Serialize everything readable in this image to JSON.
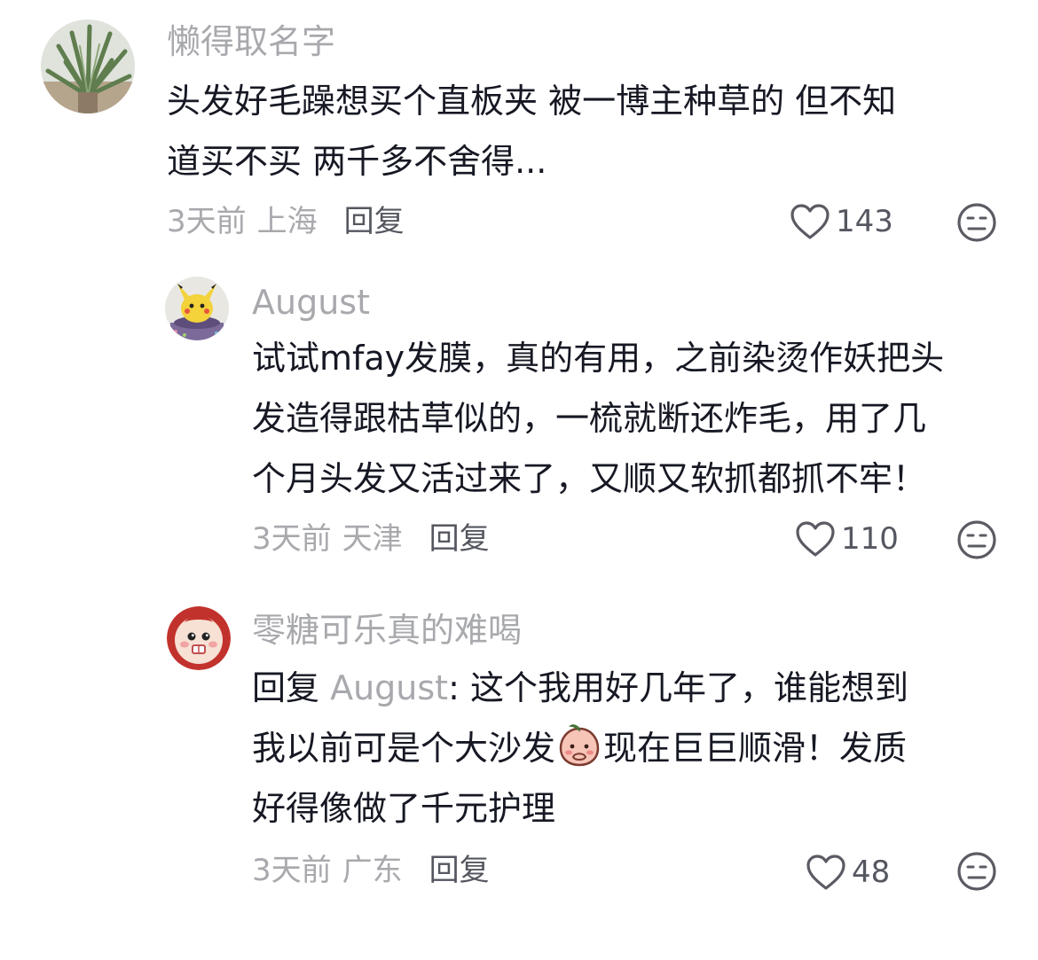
{
  "comments": [
    {
      "username": "懒得取名字",
      "lines": [
        "头发好毛躁想买个直板夹 被一博主种草的 但不知",
        "道买不买 两千多不舍得..."
      ],
      "time": "3天前",
      "location": "上海",
      "reply_label": "回复",
      "likes": "143",
      "avatar_icon": "agave-plant-avatar"
    },
    {
      "username": "August",
      "lines": [
        "试试mfay发膜，真的有用，之前染烫作妖把头",
        "发造得跟枯草似的，一梳就断还炸毛，用了几",
        "个月头发又活过来了，又顺又软抓都抓不牢！"
      ],
      "time": "3天前",
      "location": "天津",
      "reply_label": "回复",
      "likes": "110",
      "avatar_icon": "pikachu-cake-avatar"
    },
    {
      "username": "零糖可乐真的难喝",
      "reply_prefix": "回复 ",
      "reply_to": "August",
      "reply_colon": ":",
      "line1_rest": "  这个我用好几年了，谁能想到",
      "line2_before": "我以前可是个大沙发",
      "line2_after": "现在巨巨顺滑！发质",
      "line3": "好得像做了千元护理",
      "time": "3天前",
      "location": "广东",
      "reply_label": "回复",
      "likes": "48",
      "avatar_icon": "baby-face-avatar",
      "inline_emoji": "peach-shy-emoji"
    }
  ],
  "icons": {
    "like": "heart-outline-icon",
    "dislike": "unamused-face-icon"
  },
  "colors": {
    "username": "#a8a9ad",
    "content": "#161823",
    "meta": "#a8a9ad",
    "reply": "#555760",
    "icon": "#5a5b63"
  }
}
